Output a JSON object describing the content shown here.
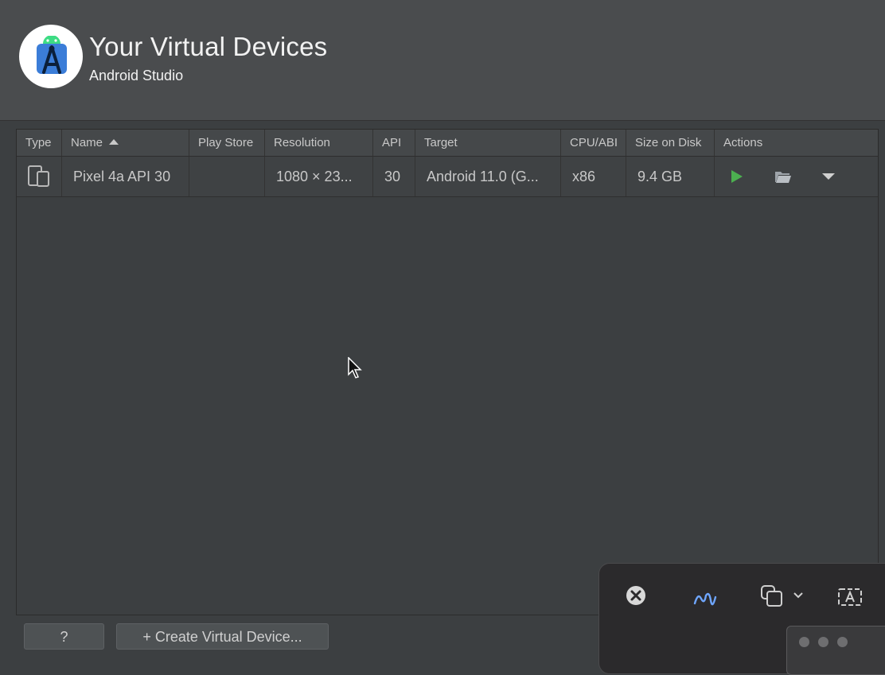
{
  "header": {
    "title": "Your Virtual Devices",
    "subtitle": "Android Studio",
    "logo_icon": "android-studio-logo"
  },
  "table": {
    "columns": [
      "Type",
      "Name",
      "Play Store",
      "Resolution",
      "API",
      "Target",
      "CPU/ABI",
      "Size on Disk",
      "Actions"
    ],
    "sorted_column": "Name",
    "rows": [
      {
        "type_icon": "phone-tablet-icon",
        "name": "Pixel 4a API 30",
        "play_store": "",
        "resolution": "1080 × 23...",
        "api": "30",
        "target": "Android 11.0 (G...",
        "cpu_abi": "x86",
        "size": "9.4 GB"
      }
    ]
  },
  "footer": {
    "help_label": "?",
    "create_label": "+ Create Virtual Device..."
  },
  "colors": {
    "background": "#3c3f41",
    "header_bg": "#4a4c4e",
    "run_green": "#4caf50"
  }
}
